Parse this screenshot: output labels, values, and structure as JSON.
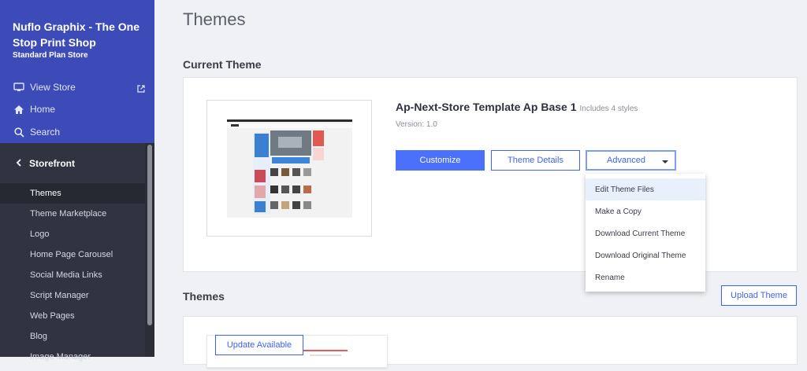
{
  "sidebar": {
    "store_name": "Nuflo Graphix - The One Stop Print Shop",
    "plan": "Standard Plan Store",
    "links": [
      {
        "label": "View Store",
        "icon": "monitor-icon"
      },
      {
        "label": "Home",
        "icon": "home-icon"
      },
      {
        "label": "Search",
        "icon": "search-icon"
      }
    ],
    "section": "Storefront",
    "items": [
      {
        "label": "Themes"
      },
      {
        "label": "Theme Marketplace"
      },
      {
        "label": "Logo"
      },
      {
        "label": "Home Page Carousel"
      },
      {
        "label": "Social Media Links"
      },
      {
        "label": "Script Manager"
      },
      {
        "label": "Web Pages"
      },
      {
        "label": "Blog"
      },
      {
        "label": "Image Manager"
      }
    ]
  },
  "main": {
    "page_title": "Themes",
    "current_theme": {
      "heading": "Current Theme",
      "name": "Ap-Next-Store Template Ap Base 1",
      "styles": "Includes 4 styles",
      "version": "Version: 1.0",
      "buttons": {
        "customize": "Customize",
        "details": "Theme Details",
        "advanced": "Advanced"
      }
    },
    "advanced_menu": [
      "Edit Theme Files",
      "Make a Copy",
      "Download Current Theme",
      "Download Original Theme",
      "Rename"
    ],
    "themes_section": {
      "heading": "Themes",
      "upload": "Upload Theme",
      "update_badge": "Update Available"
    }
  },
  "colors": {
    "sidebar_top": "#3d4bb8",
    "sidebar": "#313440",
    "primary": "#4b71fc",
    "accent": "#3c64f4"
  }
}
